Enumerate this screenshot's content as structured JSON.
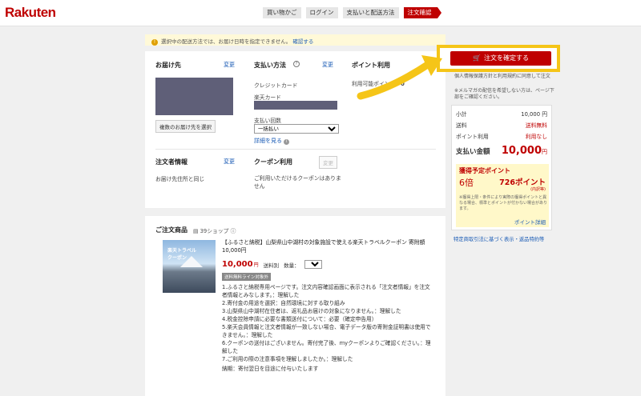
{
  "header": {
    "logo": "Rakuten",
    "steps": [
      "買い物かご",
      "ログイン",
      "支払いと配送方法",
      "注文確認"
    ]
  },
  "notice": {
    "icon": "info-icon",
    "text": "選択中の配送方法では、お届け日時を指定できません。",
    "link": "確認する"
  },
  "delivery": {
    "title": "お届け先",
    "change": "変更",
    "multi_button": "複数のお届け先を選択"
  },
  "payment": {
    "title": "支払い方法",
    "change": "変更",
    "method": "クレジットカード",
    "card_label": "楽天カード",
    "installments_label": "支払い回数",
    "installments_value": "一括払い",
    "details_link": "詳細を見る"
  },
  "points_use": {
    "title": "ポイント利用",
    "available_label": "利用可能ポイント：",
    "available_value": "0"
  },
  "orderer": {
    "title": "注文者情報",
    "change": "変更",
    "value": "お届け先住所と同じ"
  },
  "coupon": {
    "title": "クーポン利用",
    "change": "変更",
    "value": "ご利用いただけるクーポンはありません"
  },
  "confirm": {
    "button": "注文を確定する",
    "note1": "個人情報保護方針と利用規約に同意して注文",
    "note2": "※メルマガの配信を希望しない方は、ページ下部をご確認ください。"
  },
  "summary": {
    "subtotal_label": "小計",
    "subtotal_value": "10,000 円",
    "shipping_label": "送料",
    "shipping_value": "送料無料",
    "points_label": "ポイント利用",
    "points_value": "利用なし",
    "total_label": "支払い金額",
    "total_value": "10,000",
    "total_unit": "円",
    "earn_title": "獲得予定ポイント",
    "earn_multiplier": "6倍",
    "earn_points": "726ポイント",
    "earn_sub": "(内訳等)",
    "earn_note": "※獲得上限・条件により実際の獲得ポイントと異なる場合、標準とポイントが付かない場合があります。",
    "earn_link": "ポイント詳細"
  },
  "legal_link": "特定商取引法に基づく表示・返品特約等",
  "product": {
    "title": "ご注文商品",
    "shop_count": "39ショップ",
    "name": "【ふるさと納税】山梨県山中湖村の対象施設で使える楽天トラベルクーポン 寄附額 10,000円",
    "price": "10,000",
    "price_unit": "円",
    "shipping": "送料別",
    "qty_label": "数量：",
    "qty_value": "1",
    "tag": "送料無料ライン対象外",
    "lines": [
      "1.ふるさと納税専用ページです。注文内容確認画面に表示される「注文者情報」を注文者情報とみなします。：理解した",
      "2.寄付金の用途を選択：自然環境に対する取り組み",
      "3.山梨県山中湖村在住者は、返礼品お届けの対象になりません。：理解した",
      "4.税金控除申請に必要な書類送付について：必要（確定申告用）",
      "5.楽天会員情報と注文者情報が一致しない場合、電子データ版の寄附金証明書は使用できません。：理解した",
      "6.クーポンの送付はございません。寄付完了後、myクーポンよりご確認ください。：理解した",
      "7.ご利用の際の注意事項を理解しましたか。：理解した"
    ],
    "footer": "納期：寄付翌日を目途に付与いたします"
  }
}
